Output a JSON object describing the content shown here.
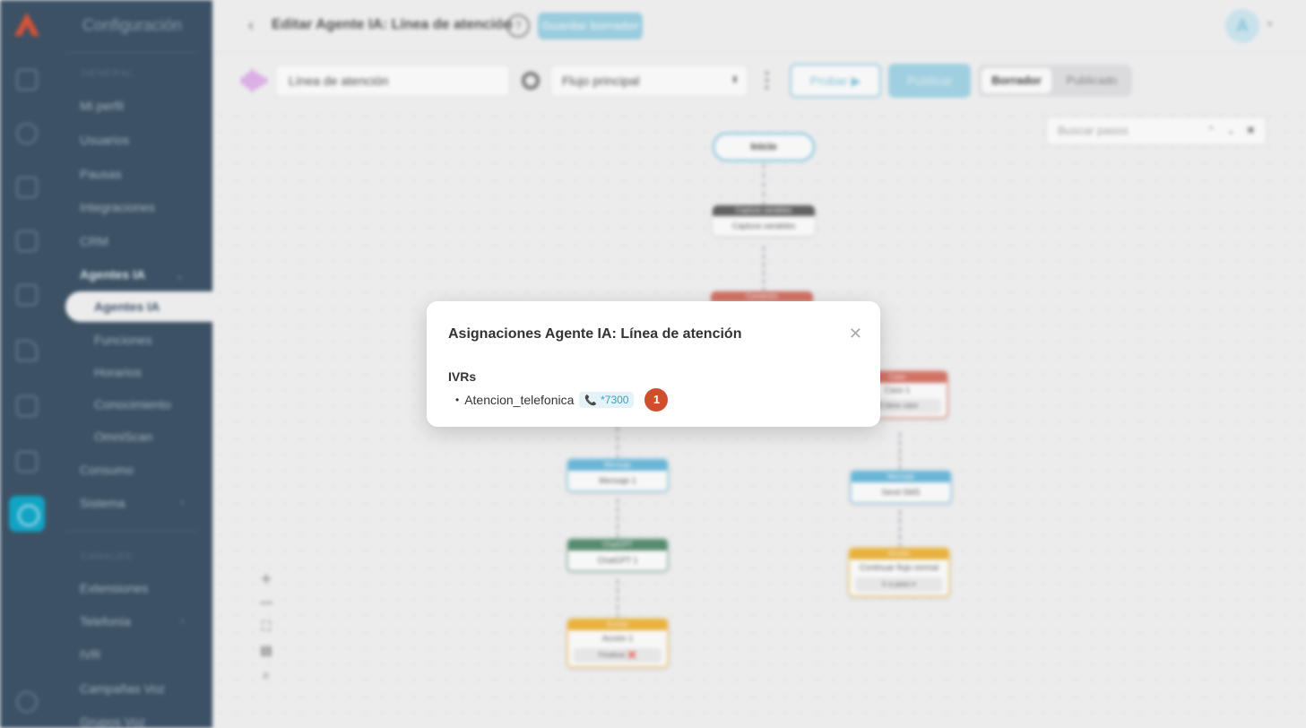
{
  "sidebar": {
    "title": "Configuración",
    "group_general": "GENERAL",
    "group_channels": "CANALES",
    "items": {
      "profile": "Mi perfil",
      "users": "Usuarios",
      "pauses": "Pausas",
      "integrations": "Integraciones",
      "crm": "CRM",
      "ai_agents": "Agentes IA",
      "ai_agents_sub": "Agentes IA",
      "functions": "Funciones",
      "schedules": "Horarios",
      "knowledge": "Conocimiento",
      "omniscan": "OmniScan",
      "consumption": "Consumo",
      "system": "Sistema",
      "extensions": "Extensiones",
      "telephony": "Telefonía",
      "ivr": "IVR",
      "voice_campaigns": "Campañas Voz",
      "voice_groups": "Grupos Voz"
    }
  },
  "header": {
    "title": "Editar Agente IA: Línea de atención",
    "help": "?",
    "save_draft": "Guardar borrador",
    "avatar_initial": "A"
  },
  "toolbar": {
    "agent_name": "Línea de atención",
    "flow": "Flujo principal",
    "test_label": "Probar",
    "publish_label": "Publicar",
    "mode_draft": "Borrador",
    "mode_published": "Publicado",
    "search_placeholder": "Buscar pasos"
  },
  "canvas": {
    "start": "Inicio",
    "nodes": {
      "capture_hdr": "Captura variables",
      "capture_body": "Captura variables",
      "condition_hdr": "Condición",
      "case_hdr": "Caso",
      "case_body": "Caso 1",
      "case_chip": "ID tiene valor",
      "msg1_hdr": "Mensaje",
      "msg1_body": "Mensaje 1",
      "msg2_hdr": "Mensaje",
      "msg2_body": "Send SMS",
      "gpt_hdr": "ChatGPT",
      "gpt_body": "ChatGPT 1",
      "action1_hdr": "Acción",
      "action1_body": "Acción 1",
      "action1_chip": "Finalizar ❌",
      "action2_hdr": "Acción",
      "action2_body": "Continuar flujo normal",
      "action2_chip": "Ir a paso ⏸"
    }
  },
  "modal": {
    "title": "Asignaciones Agente IA: Línea de atención",
    "section": "IVRs",
    "ivr_name": "Atencion_telefonica",
    "extension": "*7300",
    "count": "1"
  },
  "colors": {
    "sidebar_bg": "#3e5468",
    "accent": "#12aacc",
    "badge": "#cf4f2c",
    "node_gray": "#666666",
    "node_red": "#d9776a",
    "node_blue": "#6ebcdd",
    "node_green": "#5a8f74",
    "node_yellow": "#f0b840"
  }
}
